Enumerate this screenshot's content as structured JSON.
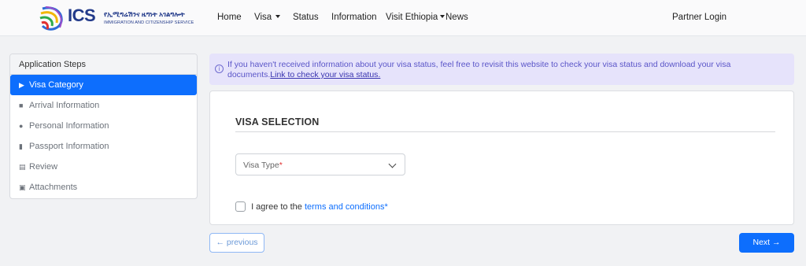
{
  "brand": {
    "short": "ICS",
    "amharic": "የኢሚግሬሽንና ዜግነት አገልግሎት",
    "english": "IMMIGRATION AND CITIZENSHIP SERVICE"
  },
  "nav": {
    "items": [
      {
        "label": "Home",
        "has_caret": false
      },
      {
        "label": "Visa",
        "has_caret": true
      },
      {
        "label": "Status",
        "has_caret": false
      },
      {
        "label": "Information",
        "has_caret": false
      },
      {
        "label": "Visit Ethiopia",
        "has_caret": true
      },
      {
        "label": "News",
        "has_caret": false
      }
    ],
    "partner_login": "Partner Login"
  },
  "steps": {
    "heading": "Application Steps",
    "items": [
      {
        "label": "Visa Category",
        "icon": "play-icon",
        "active": true
      },
      {
        "label": "Arrival Information",
        "icon": "car-icon",
        "active": false
      },
      {
        "label": "Personal Information",
        "icon": "user-icon",
        "active": false
      },
      {
        "label": "Passport Information",
        "icon": "document-icon",
        "active": false
      },
      {
        "label": "Review",
        "icon": "review-icon",
        "active": false
      },
      {
        "label": "Attachments",
        "icon": "attachment-icon",
        "active": false
      }
    ]
  },
  "alert": {
    "text": "If you haven't received information about your visa status, feel free to revisit this website to check your visa status and download your visa documents.",
    "link": "Link to check your visa status.",
    "color": "#e6e3fb"
  },
  "form": {
    "title": "VISA SELECTION",
    "visa_type_placeholder": "Visa Type",
    "required_mark": "*",
    "agree_prefix": "I agree to the",
    "agree_link": "terms and conditions",
    "agree_required": "*"
  },
  "buttons": {
    "previous": "← previous",
    "next": "Next →"
  },
  "colors": {
    "accent": "#0d6efd",
    "brand": "#223a8a"
  }
}
